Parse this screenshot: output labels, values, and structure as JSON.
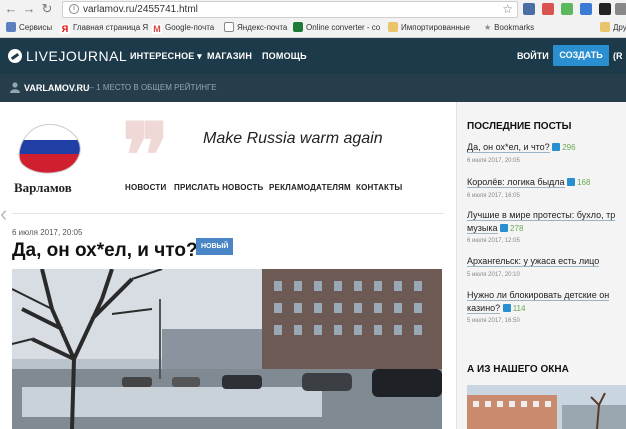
{
  "browser": {
    "url": "varlamov.ru/2455741.html",
    "bookmarks": [
      "Сервисы",
      "Главная страница Я",
      "Google-почта",
      "Яндекс-почта",
      "Online converter - co",
      "Импортированные",
      "Bookmarks",
      "Дру"
    ]
  },
  "lj": {
    "logo": "LIVEJOURNAL",
    "menu": [
      "ИНТЕРЕСНОЕ ▾",
      "МАГАЗИН",
      "ПОМОЩЬ"
    ],
    "login": "ВОЙТИ",
    "create": "СОЗДАТЬ",
    "lang": "(R",
    "journal": "VARLAMOV.RU",
    "rank": "— 1 МЕСТО В ОБЩЕМ РЕЙТИНГЕ"
  },
  "blog": {
    "logo_text": "Варламов",
    "slogan": "Make Russia warm again",
    "nav": [
      "НОВОСТИ",
      "ПРИСЛАТЬ НОВОСТЬ",
      "РЕКЛАМОДАТЕЛЯМ",
      "КОНТАКТЫ"
    ]
  },
  "post": {
    "date": "6 июля 2017, 20:05",
    "title": "Да, он ох*ел, и что?",
    "badge": "НОВЫЙ"
  },
  "sidebar": {
    "latest_title": "ПОСЛЕДНИЕ ПОСТЫ",
    "posts": [
      {
        "title": "Да, он ох*ел, и что?",
        "date": "6 июля 2017, 20:05",
        "likes": "296"
      },
      {
        "title": "Королёв: логика быдла",
        "date": "6 июля 2017, 16:05",
        "likes": "168"
      },
      {
        "title": "Лучшие в мире протесты: бухло, тр",
        "title2": "музыка",
        "date": "6 июля 2017, 12:05",
        "likes": "278"
      },
      {
        "title": "Архангельск: у ужаса есть лицо",
        "date": "5 июля 2017, 20:10",
        "likes": ""
      },
      {
        "title": "Нужно ли блокировать детские он",
        "title2": "казино?",
        "date": "5 июля 2017, 16:50",
        "likes": "114"
      }
    ],
    "window_title": "А ИЗ НАШЕГО ОКНА"
  }
}
